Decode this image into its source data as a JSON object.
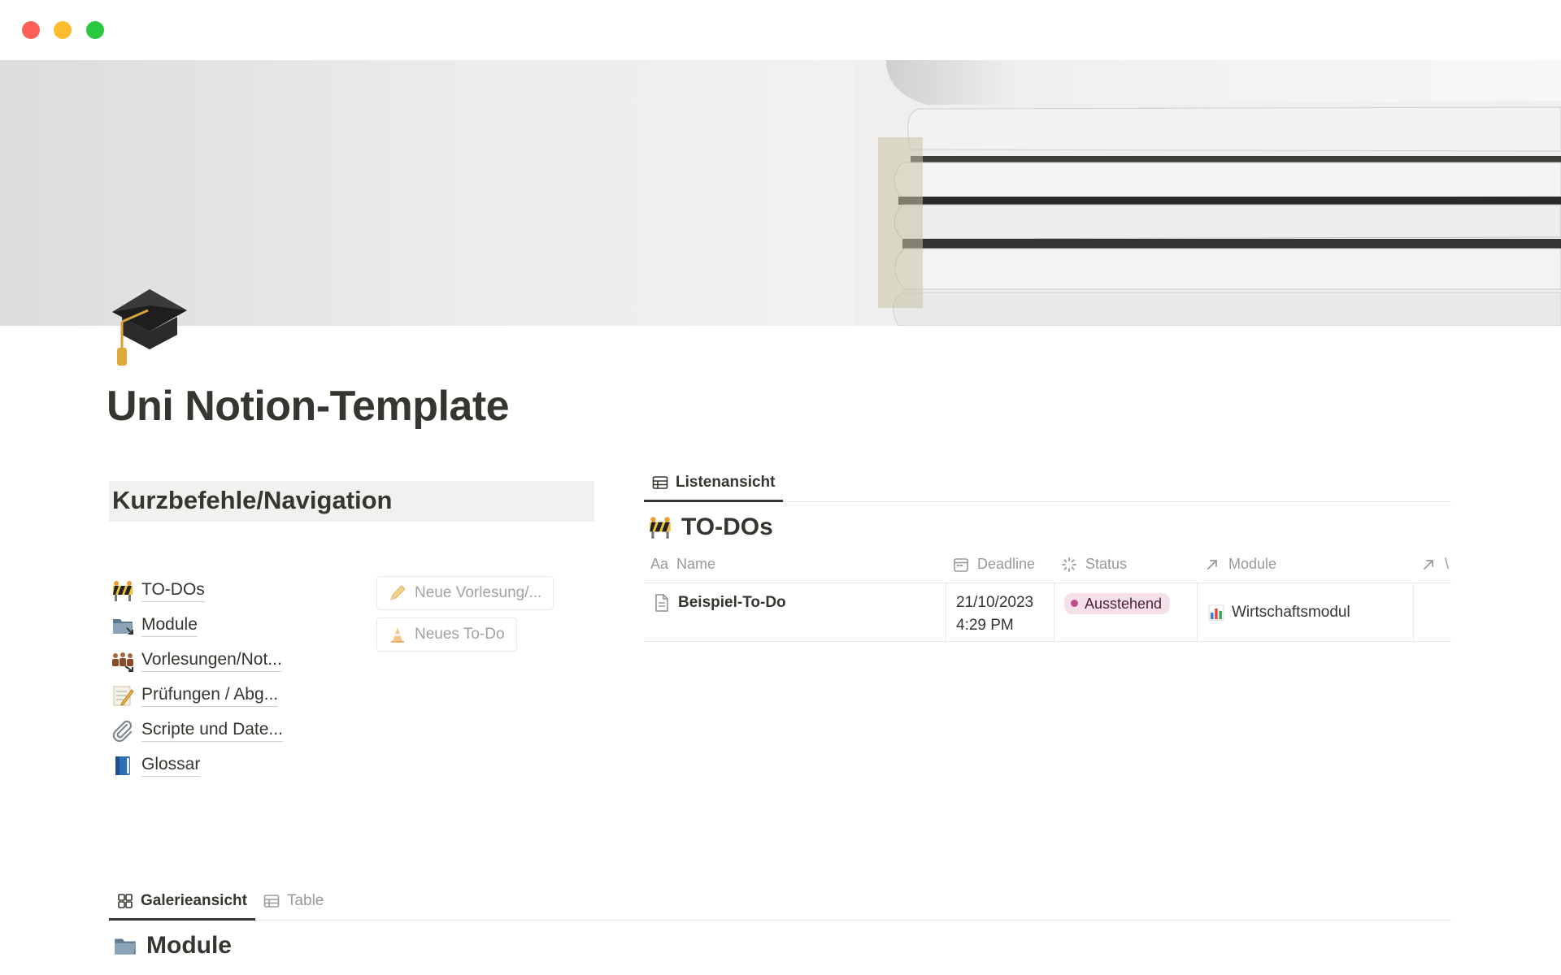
{
  "page": {
    "title": "Uni Notion-Template",
    "icon": "graduation-cap-icon"
  },
  "shortcuts": {
    "heading": "Kurzbefehle/Navigation",
    "items": [
      {
        "label": "TO-DOs",
        "icon": "construction-icon"
      },
      {
        "label": "Module",
        "icon": "folder-icon"
      },
      {
        "label": "Vorlesungen/Not...",
        "icon": "people-icon"
      },
      {
        "label": "Prüfungen / Abg...",
        "icon": "memo-icon"
      },
      {
        "label": "Scripte und Date...",
        "icon": "paperclip-icon"
      },
      {
        "label": "Glossar",
        "icon": "book-icon"
      }
    ],
    "buttons": [
      {
        "label": "Neue Vorlesung/...",
        "icon": "pencil-icon"
      },
      {
        "label": "Neues To-Do",
        "icon": "traffic-cone-icon"
      }
    ]
  },
  "todos_view": {
    "tab_label": "Listenansicht",
    "title": "TO-DOs",
    "columns": [
      {
        "label": "Name",
        "icon": "Aa"
      },
      {
        "label": "Deadline",
        "icon": "calendar-icon"
      },
      {
        "label": "Status",
        "icon": "status-icon"
      },
      {
        "label": "Module",
        "icon": "relation-arrow-icon"
      },
      {
        "label": "\\",
        "icon": "relation-arrow-icon"
      }
    ],
    "rows": [
      {
        "name": "Beispiel-To-Do",
        "deadline_date": "21/10/2023",
        "deadline_time": "4:29 PM",
        "status": "Ausstehend",
        "module": "Wirtschaftsmodul"
      }
    ]
  },
  "modules_view": {
    "tabs": [
      {
        "label": "Galerieansicht",
        "icon": "gallery-icon",
        "active": true
      },
      {
        "label": "Table",
        "icon": "table-icon",
        "active": false
      }
    ],
    "title": "Module"
  },
  "colors": {
    "text": "#37352f",
    "muted": "#9b9a97",
    "status_bg": "#f5e0e9",
    "status_dot": "#c14c8a"
  }
}
